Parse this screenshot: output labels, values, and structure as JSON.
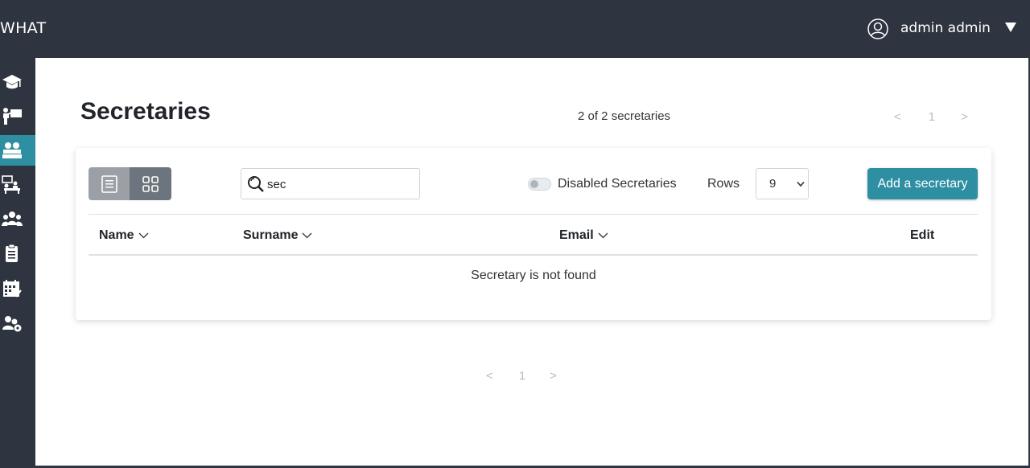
{
  "header": {
    "brand": "WHAT",
    "user_name": "admin admin",
    "background": "#2e3440"
  },
  "sidebar": {
    "active_color": "#2e8fa3",
    "items": [
      {
        "icon": "graduation-cap-icon",
        "active": false
      },
      {
        "icon": "teacher-board-icon",
        "active": false
      },
      {
        "icon": "secretaries-icon",
        "active": true
      },
      {
        "icon": "mentor-desk-icon",
        "active": false
      },
      {
        "icon": "users-group-icon",
        "active": false
      },
      {
        "icon": "clipboard-icon",
        "active": false
      },
      {
        "icon": "calendar-icon",
        "active": false
      },
      {
        "icon": "users-cog-icon",
        "active": false
      }
    ]
  },
  "main": {
    "title": "Secretaries",
    "count_text": "2 of 2 secretaries",
    "pagination": {
      "prev": "<",
      "page": "1",
      "next": ">"
    }
  },
  "toolbar": {
    "view_modes": [
      {
        "icon": "list-view-icon",
        "active": true
      },
      {
        "icon": "grid-view-icon",
        "active": false
      }
    ],
    "search_value": "sec",
    "disabled_toggle_label": "Disabled Secretaries",
    "disabled_toggle_on": false,
    "rows_label": "Rows",
    "rows_value": "9",
    "add_button_label": "Add a secretary",
    "accent_color": "#2e8fa3"
  },
  "table": {
    "columns": [
      "Name",
      "Surname",
      "Email",
      "Edit"
    ],
    "empty_message": "Secretary is not found"
  }
}
